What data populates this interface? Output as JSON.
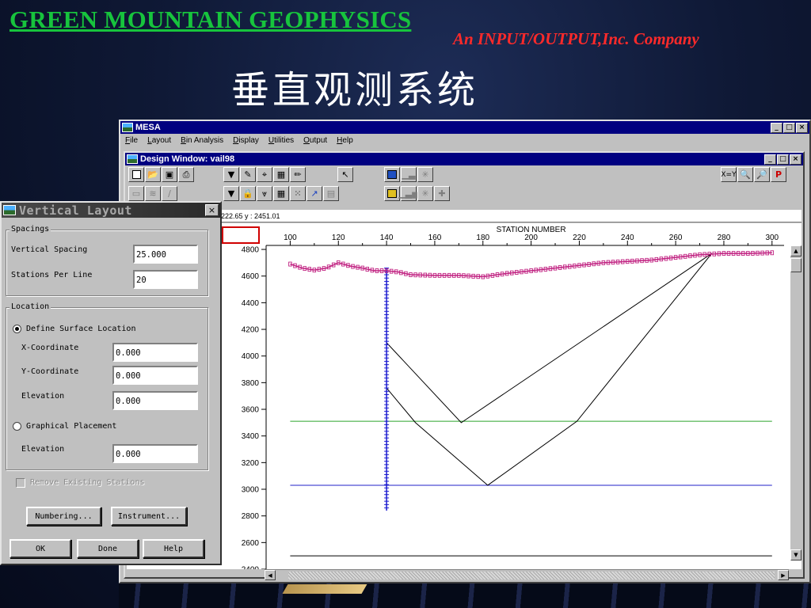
{
  "slide": {
    "company": "GREEN MOUNTAIN GEOPHYSICS",
    "subtitle": "An INPUT/OUTPUT,Inc. Company",
    "title": "垂直观测系统"
  },
  "mesa": {
    "title": "MESA",
    "menu": [
      "File",
      "Layout",
      "Bin Analysis",
      "Display",
      "Utilities",
      "Output",
      "Help"
    ],
    "window_buttons": [
      "_",
      "□",
      "×"
    ]
  },
  "design_window": {
    "title": "Design Window: vail98",
    "coordinate_text": "222.65 y : 2451.01",
    "toolbar_right": [
      "X=Y",
      "zoom-out",
      "zoom-in",
      "P"
    ]
  },
  "chart_data": {
    "type": "line",
    "xlabel": "STATION NUMBER",
    "x_ticks": [
      100,
      120,
      140,
      160,
      180,
      200,
      220,
      240,
      260,
      280,
      300
    ],
    "y_ticks": [
      4800,
      4600,
      4400,
      4200,
      4000,
      3800,
      3600,
      3400,
      3200,
      3000,
      2800,
      2600,
      2400
    ],
    "xlim": [
      90,
      305
    ],
    "ylim": [
      2400,
      4830
    ],
    "surface_x": [
      100,
      105,
      110,
      115,
      120,
      125,
      130,
      135,
      140,
      145,
      150,
      160,
      170,
      180,
      190,
      200,
      210,
      220,
      230,
      240,
      250,
      260,
      270,
      280,
      290,
      300
    ],
    "surface_y": [
      4690,
      4660,
      4645,
      4660,
      4700,
      4675,
      4660,
      4640,
      4640,
      4630,
      4610,
      4605,
      4605,
      4595,
      4620,
      4640,
      4660,
      4680,
      4700,
      4710,
      4720,
      4740,
      4760,
      4770,
      4770,
      4775
    ],
    "well_x": 140,
    "well_y_top": 4660,
    "well_y_bottom": 2840,
    "ray_path_1": {
      "x": [
        140,
        171,
        275
      ],
      "y": [
        4100,
        3500,
        4770
      ]
    },
    "ray_path_2": {
      "x": [
        140,
        152,
        182,
        219,
        275
      ],
      "y": [
        3760,
        3500,
        3030,
        3510,
        4770
      ]
    },
    "horizons": [
      {
        "y": 3510,
        "color": "#2aa52a"
      },
      {
        "y": 3030,
        "color": "#2020c8"
      },
      {
        "y": 2500,
        "color": "#000000"
      }
    ],
    "surface_color": "#c02080",
    "well_color": "#1a1ad0"
  },
  "dialog": {
    "title": "Vertical Layout",
    "close": "×",
    "spacings": {
      "label": "Spacings",
      "vertical_spacing_label": "Vertical Spacing",
      "vertical_spacing_value": "25.000",
      "stations_per_line_label": "Stations Per Line",
      "stations_per_line_value": "20"
    },
    "location": {
      "label": "Location",
      "define_surface_label": "Define Surface Location",
      "x_label": "X-Coordinate",
      "x_value": "0.000",
      "y_label": "Y-Coordinate",
      "y_value": "0.000",
      "elevation_label": "Elevation",
      "elevation_value": "0.000",
      "graphical_label": "Graphical Placement",
      "elevation2_label": "Elevation",
      "elevation2_value": "0.000"
    },
    "remove_existing": "Remove Existing Stations",
    "buttons": {
      "numbering": "Numbering...",
      "instrument": "Instrument...",
      "ok": "OK",
      "done": "Done",
      "help": "Help"
    }
  }
}
